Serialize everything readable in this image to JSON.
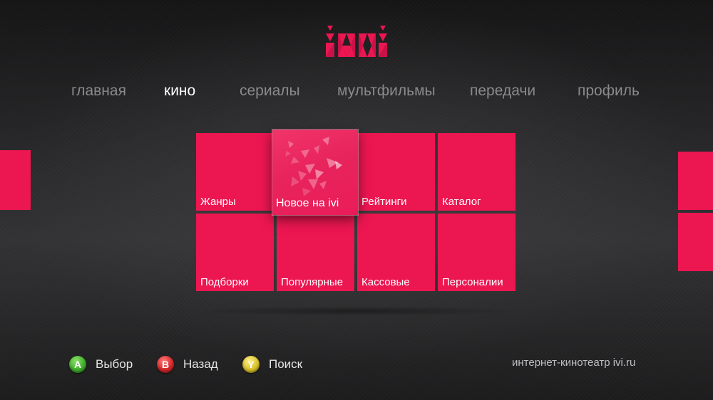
{
  "brand": {
    "logo": "ivi",
    "accent_color": "#ec1651"
  },
  "nav": {
    "items": [
      {
        "label": "главная"
      },
      {
        "label": "кино",
        "active": true
      },
      {
        "label": "сериалы"
      },
      {
        "label": "мультфильмы"
      },
      {
        "label": "передачи"
      },
      {
        "label": "профиль"
      }
    ]
  },
  "tiles": [
    {
      "label": "Жанры"
    },
    {
      "label": "Новое на ivi",
      "focused": true
    },
    {
      "label": "Рейтинги"
    },
    {
      "label": "Каталог"
    },
    {
      "label": "Подборки"
    },
    {
      "label": "Популярные"
    },
    {
      "label": "Кассовые"
    },
    {
      "label": "Персоналии"
    }
  ],
  "footer": {
    "hints": [
      {
        "key": "A",
        "label": "Выбор",
        "color": "#3fae2c"
      },
      {
        "key": "B",
        "label": "Назад",
        "color": "#d8282b"
      },
      {
        "key": "Y",
        "label": "Поиск",
        "color": "#d9c22b"
      }
    ],
    "site": "интернет-кинотеатр ivi.ru"
  }
}
